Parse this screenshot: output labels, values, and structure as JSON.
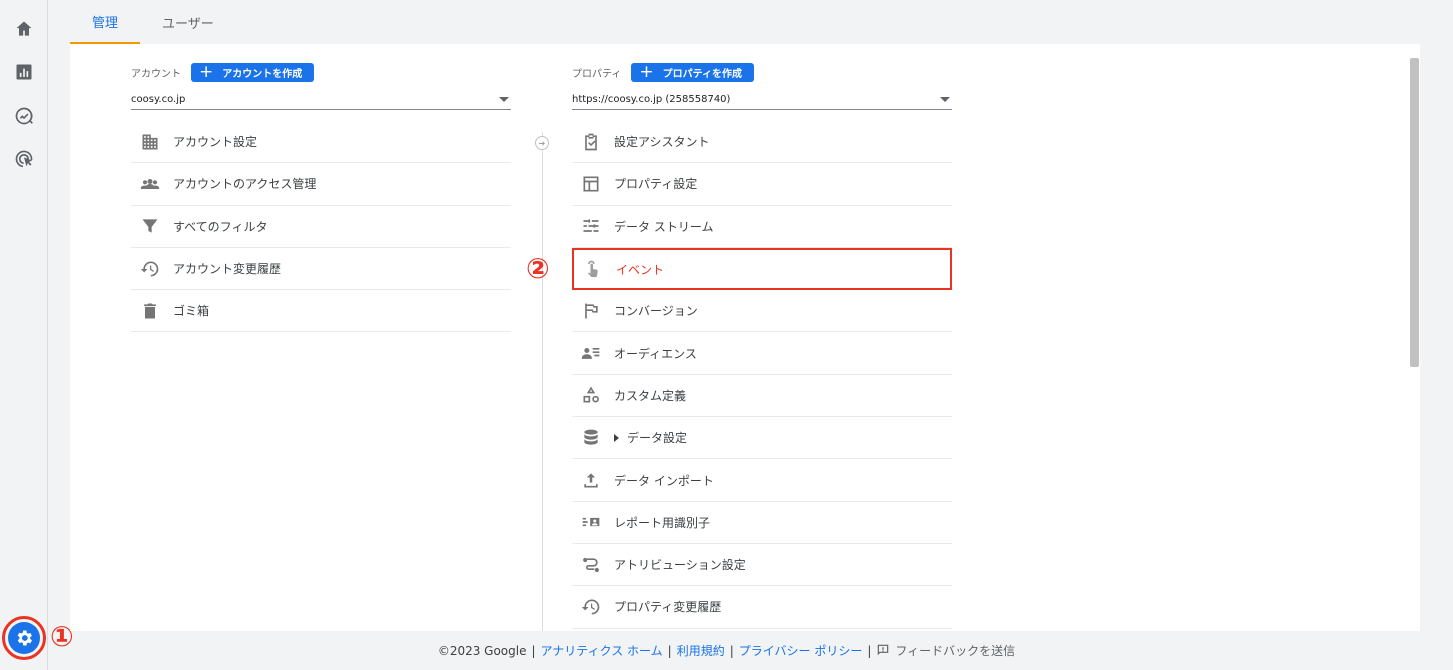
{
  "rail": {
    "items": [
      {
        "name": "home-icon"
      },
      {
        "name": "reports-icon"
      },
      {
        "name": "explore-icon"
      },
      {
        "name": "advertising-icon"
      }
    ],
    "settings_icon": "gear-icon"
  },
  "callouts": {
    "one": "①",
    "two": "②"
  },
  "tabs": [
    {
      "label": "管理"
    },
    {
      "label": "ユーザー"
    }
  ],
  "account": {
    "label": "アカウント",
    "create_label": "アカウントを作成",
    "selected": "coosy.co.jp",
    "items": [
      {
        "label": "アカウント設定",
        "icon": "building-icon"
      },
      {
        "label": "アカウントのアクセス管理",
        "icon": "people-icon"
      },
      {
        "label": "すべてのフィルタ",
        "icon": "filter-icon"
      },
      {
        "label": "アカウント変更履歴",
        "icon": "history-icon"
      },
      {
        "label": "ゴミ箱",
        "icon": "trash-icon"
      }
    ]
  },
  "property": {
    "label": "プロパティ",
    "create_label": "プロパティを作成",
    "selected": "https://coosy.co.jp (258558740)",
    "items": [
      {
        "label": "設定アシスタント",
        "icon": "checklist-icon"
      },
      {
        "label": "プロパティ設定",
        "icon": "layout-icon"
      },
      {
        "label": "データ ストリーム",
        "icon": "stream-icon"
      },
      {
        "label": "イベント",
        "icon": "touch-icon"
      },
      {
        "label": "コンバージョン",
        "icon": "flag-icon"
      },
      {
        "label": "オーディエンス",
        "icon": "audience-icon"
      },
      {
        "label": "カスタム定義",
        "icon": "shapes-icon"
      },
      {
        "label": "データ設定",
        "icon": "database-icon"
      },
      {
        "label": "データ インポート",
        "icon": "upload-icon"
      },
      {
        "label": "レポート用識別子",
        "icon": "identity-icon"
      },
      {
        "label": "アトリビューション設定",
        "icon": "attribution-icon"
      },
      {
        "label": "プロパティ変更履歴",
        "icon": "history-icon"
      }
    ]
  },
  "footer": {
    "copyright": "©2023 Google",
    "links": [
      "アナリティクス ホーム",
      "利用規約",
      "プライバシー ポリシー"
    ],
    "feedback": "フィードバックを送信"
  }
}
